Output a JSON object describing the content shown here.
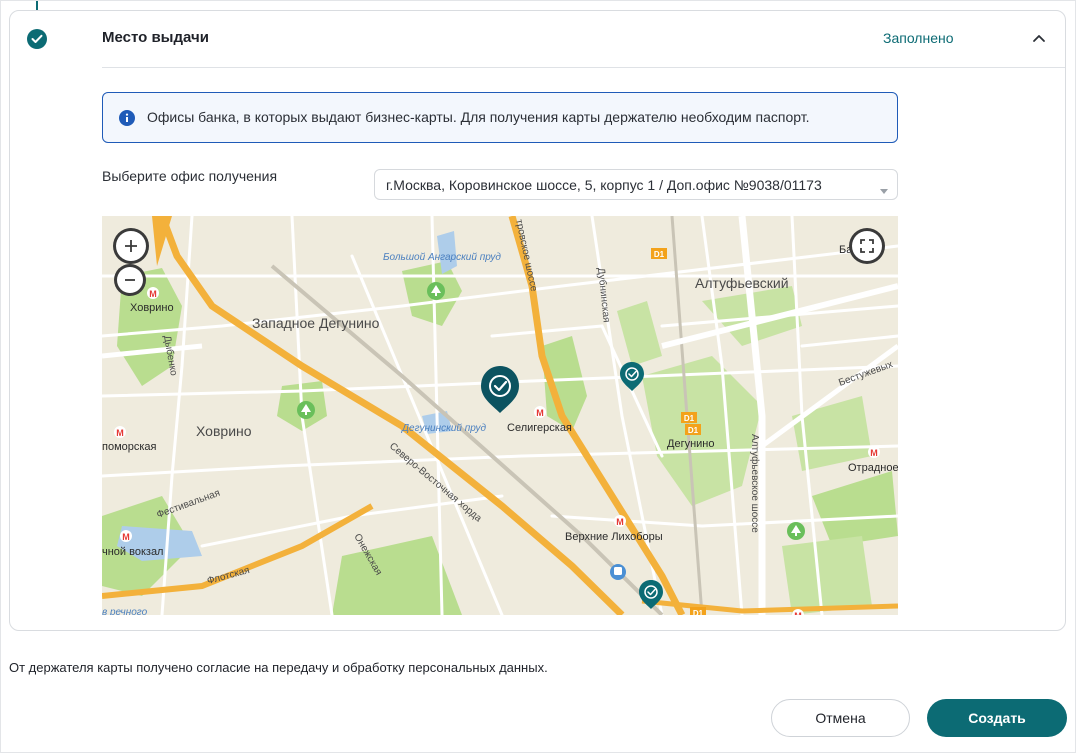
{
  "section": {
    "title": "Место выдачи",
    "status": "Заполнено"
  },
  "info": {
    "text": "Офисы банка, в которых выдают бизнес-карты. Для получения карты держателю необходим паспорт."
  },
  "office": {
    "label": "Выберите офис получения",
    "selected": "г.Москва, Коровинское шоссе, 5, корпус 1 / Доп.офис №9038/01173"
  },
  "map": {
    "labels": {
      "zapadnoe_degunino": "Западное Дегунино",
      "altufevsky": "Алтуфьевский",
      "khovrino_district": "Ховрино",
      "khovrino_station": "Ховрино",
      "bolshoy_pond": "Большой Ангарский пруд",
      "degunino_pond": "Дегунинский пруд",
      "seligerskaya": "Селигерская",
      "degunino_station": "Дегунино",
      "verkhnie_likhobory": "Верхние Лихоборы",
      "otradnoe": "Отрадное",
      "dubninskaya": "Дубнинская",
      "dybenko": "Дыбенко",
      "severo_vostochnaya": "Северо-Восточная хорда",
      "onezhskaya": "Онежская",
      "festivalnaya": "Фестивальная",
      "flotskaya": "Флотская",
      "rechnoy_vokzal": "чной вокзал",
      "altufevskoe_shosse": "Алтуфьевское шоссе",
      "dmitrovskoe_shosse": "тровское шоссе",
      "bestuzhevykh": "Бестужевых",
      "ba_label": "Ба",
      "pomorskaya": "поморская",
      "v_rechnoy": "в речного",
      "d1": "D1",
      "metro_letter": "M"
    }
  },
  "consent": {
    "text": "От держателя карты получено согласие на передачу и обработку персональных данных."
  },
  "buttons": {
    "cancel": "Отмена",
    "create": "Создать"
  },
  "colors": {
    "accent": "#0c6b74",
    "info_border": "#1f5bb8",
    "map_park": "#b9dd8f",
    "map_water": "#aecdea",
    "map_highway": "#f3b13b"
  }
}
